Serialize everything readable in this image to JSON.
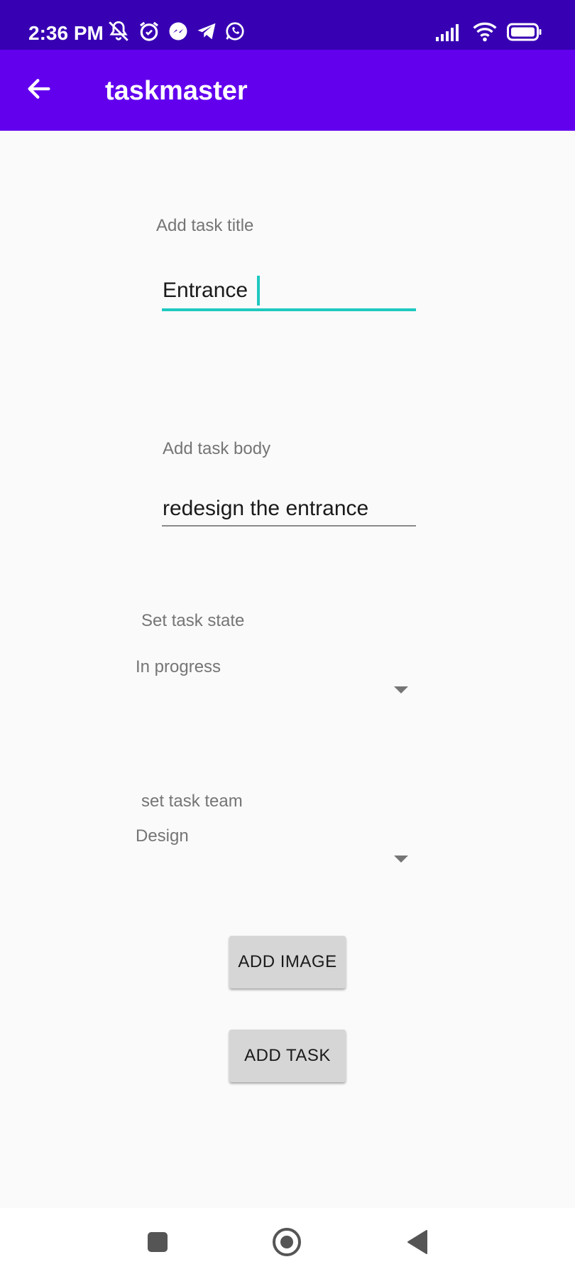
{
  "status_bar": {
    "time": "2:36 PM",
    "left_icons": [
      "mute-notifications-icon",
      "alarm-icon",
      "messenger-icon",
      "telegram-icon",
      "whatsapp-icon"
    ],
    "right_icons": [
      "signal-icon",
      "wifi-icon",
      "battery-icon"
    ]
  },
  "app_bar": {
    "title": "taskmaster",
    "back_icon": "arrow-back-icon"
  },
  "form": {
    "title_label": "Add task title",
    "title_value": "Entrance",
    "body_label": "Add task body",
    "body_value": "redesign the entrance",
    "state_label": "Set task state",
    "state_selected": "In progress",
    "team_label": "set task team",
    "team_selected": "Design"
  },
  "buttons": {
    "add_image": "ADD IMAGE",
    "add_task": "ADD TASK"
  },
  "nav_bar": {
    "icons": [
      "recent-apps-icon",
      "home-icon",
      "back-nav-icon"
    ]
  },
  "colors": {
    "status_bar": "#3700b3",
    "app_bar": "#6200ee",
    "accent": "#1ec9c0"
  }
}
